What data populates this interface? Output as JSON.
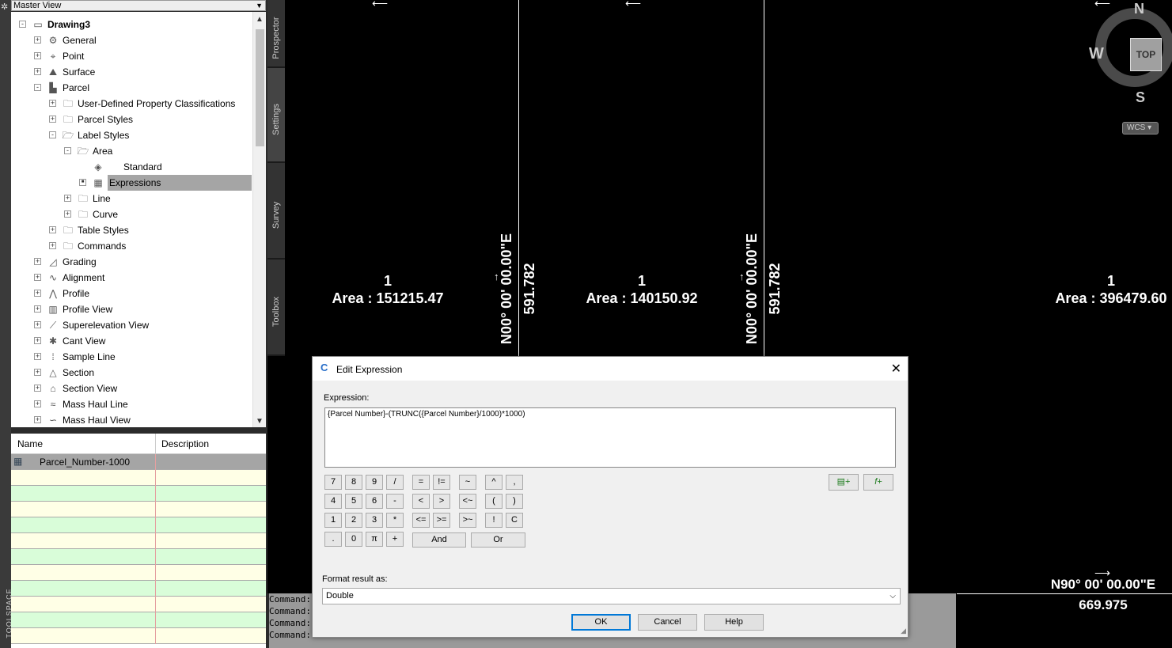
{
  "toolspace": {
    "vertical_label": "TOOLSPACE",
    "master_view": "Master View",
    "tree": [
      {
        "label": "Drawing3",
        "icon": "drawing-icon",
        "level": 0,
        "expander": "-",
        "bold": true
      },
      {
        "label": "General",
        "icon": "gear-icon",
        "level": 1,
        "expander": "+"
      },
      {
        "label": "Point",
        "icon": "point-icon",
        "level": 1,
        "expander": "+"
      },
      {
        "label": "Surface",
        "icon": "surface-icon",
        "level": 1,
        "expander": "+"
      },
      {
        "label": "Parcel",
        "icon": "parcel-icon",
        "level": 1,
        "expander": "-"
      },
      {
        "label": "User-Defined Property Classifications",
        "icon": "folder-icon",
        "level": 2,
        "expander": "+"
      },
      {
        "label": "Parcel Styles",
        "icon": "folder-icon",
        "level": 2,
        "expander": "+"
      },
      {
        "label": "Label Styles",
        "icon": "folder-open-icon",
        "level": 2,
        "expander": "-"
      },
      {
        "label": "Area",
        "icon": "folder-open-icon",
        "level": 3,
        "expander": "-"
      },
      {
        "label": "Standard",
        "icon": "label-style-icon",
        "level": 4,
        "expander": ""
      },
      {
        "label": "Expressions",
        "icon": "expressions-icon",
        "level": 4,
        "expander": "box",
        "selected": true
      },
      {
        "label": "Line",
        "icon": "folder-icon",
        "level": 3,
        "expander": "+"
      },
      {
        "label": "Curve",
        "icon": "folder-icon",
        "level": 3,
        "expander": "+"
      },
      {
        "label": "Table Styles",
        "icon": "folder-icon",
        "level": 2,
        "expander": "+"
      },
      {
        "label": "Commands",
        "icon": "folder-icon",
        "level": 2,
        "expander": "+"
      },
      {
        "label": "Grading",
        "icon": "grading-icon",
        "level": 1,
        "expander": "+"
      },
      {
        "label": "Alignment",
        "icon": "alignment-icon",
        "level": 1,
        "expander": "+"
      },
      {
        "label": "Profile",
        "icon": "profile-icon",
        "level": 1,
        "expander": "+"
      },
      {
        "label": "Profile View",
        "icon": "profile-view-icon",
        "level": 1,
        "expander": "+"
      },
      {
        "label": "Superelevation View",
        "icon": "superelevation-icon",
        "level": 1,
        "expander": "+"
      },
      {
        "label": "Cant View",
        "icon": "cant-view-icon",
        "level": 1,
        "expander": "+"
      },
      {
        "label": "Sample Line",
        "icon": "sample-line-icon",
        "level": 1,
        "expander": "+"
      },
      {
        "label": "Section",
        "icon": "section-icon",
        "level": 1,
        "expander": "+"
      },
      {
        "label": "Section View",
        "icon": "section-view-icon",
        "level": 1,
        "expander": "+"
      },
      {
        "label": "Mass Haul Line",
        "icon": "mass-haul-line-icon",
        "level": 1,
        "expander": "+"
      },
      {
        "label": "Mass Haul View",
        "icon": "mass-haul-view-icon",
        "level": 1,
        "expander": "+"
      }
    ],
    "grid": {
      "col_name": "Name",
      "col_description": "Description",
      "rows": [
        {
          "name": "Parcel_Number-1000",
          "description": ""
        }
      ]
    },
    "tabs": [
      "Prospector",
      "Settings",
      "Survey",
      "Toolbox"
    ],
    "active_tab": "Settings"
  },
  "drawing": {
    "parcels": [
      {
        "number": "1",
        "area": "Area : 151215.47"
      },
      {
        "number": "1",
        "area": "Area : 140150.92"
      },
      {
        "number": "1",
        "area": "Area : 396479.60"
      }
    ],
    "bearings": [
      {
        "bearing": "N00° 00' 00.00\"E",
        "distance": "591.782"
      },
      {
        "bearing": "N00° 00' 00.00\"E",
        "distance": "591.782"
      }
    ],
    "bottom_bearing": "N90° 00' 00.00\"E",
    "bottom_distance": "669.975"
  },
  "viewcube": {
    "n": "N",
    "w": "W",
    "s": "S",
    "top": "TOP",
    "wcs": "WCS"
  },
  "command_lines": [
    "Command:",
    "Command:",
    "Command:",
    "Command:"
  ],
  "dialog": {
    "title": "Edit Expression",
    "expression_label": "Expression:",
    "expression": "{Parcel Number}-(TRUNC({Parcel Number}/1000)*1000)",
    "keypad": [
      [
        "7",
        "8",
        "9",
        "/"
      ],
      [
        "4",
        "5",
        "6",
        "-"
      ],
      [
        "1",
        "2",
        "3",
        "*"
      ],
      [
        ".",
        "0",
        "π",
        "+"
      ]
    ],
    "operators": [
      [
        "=",
        "!=",
        "~",
        "^",
        ","
      ],
      [
        "<",
        ">",
        "<~",
        "(",
        ")"
      ],
      [
        "<=",
        ">=",
        ">~",
        "!",
        "C"
      ]
    ],
    "and_label": "And",
    "or_label": "Or",
    "format_label": "Format result as:",
    "format_value": "Double",
    "ok": "OK",
    "cancel": "Cancel",
    "help": "Help",
    "accent": "#0078d7"
  }
}
